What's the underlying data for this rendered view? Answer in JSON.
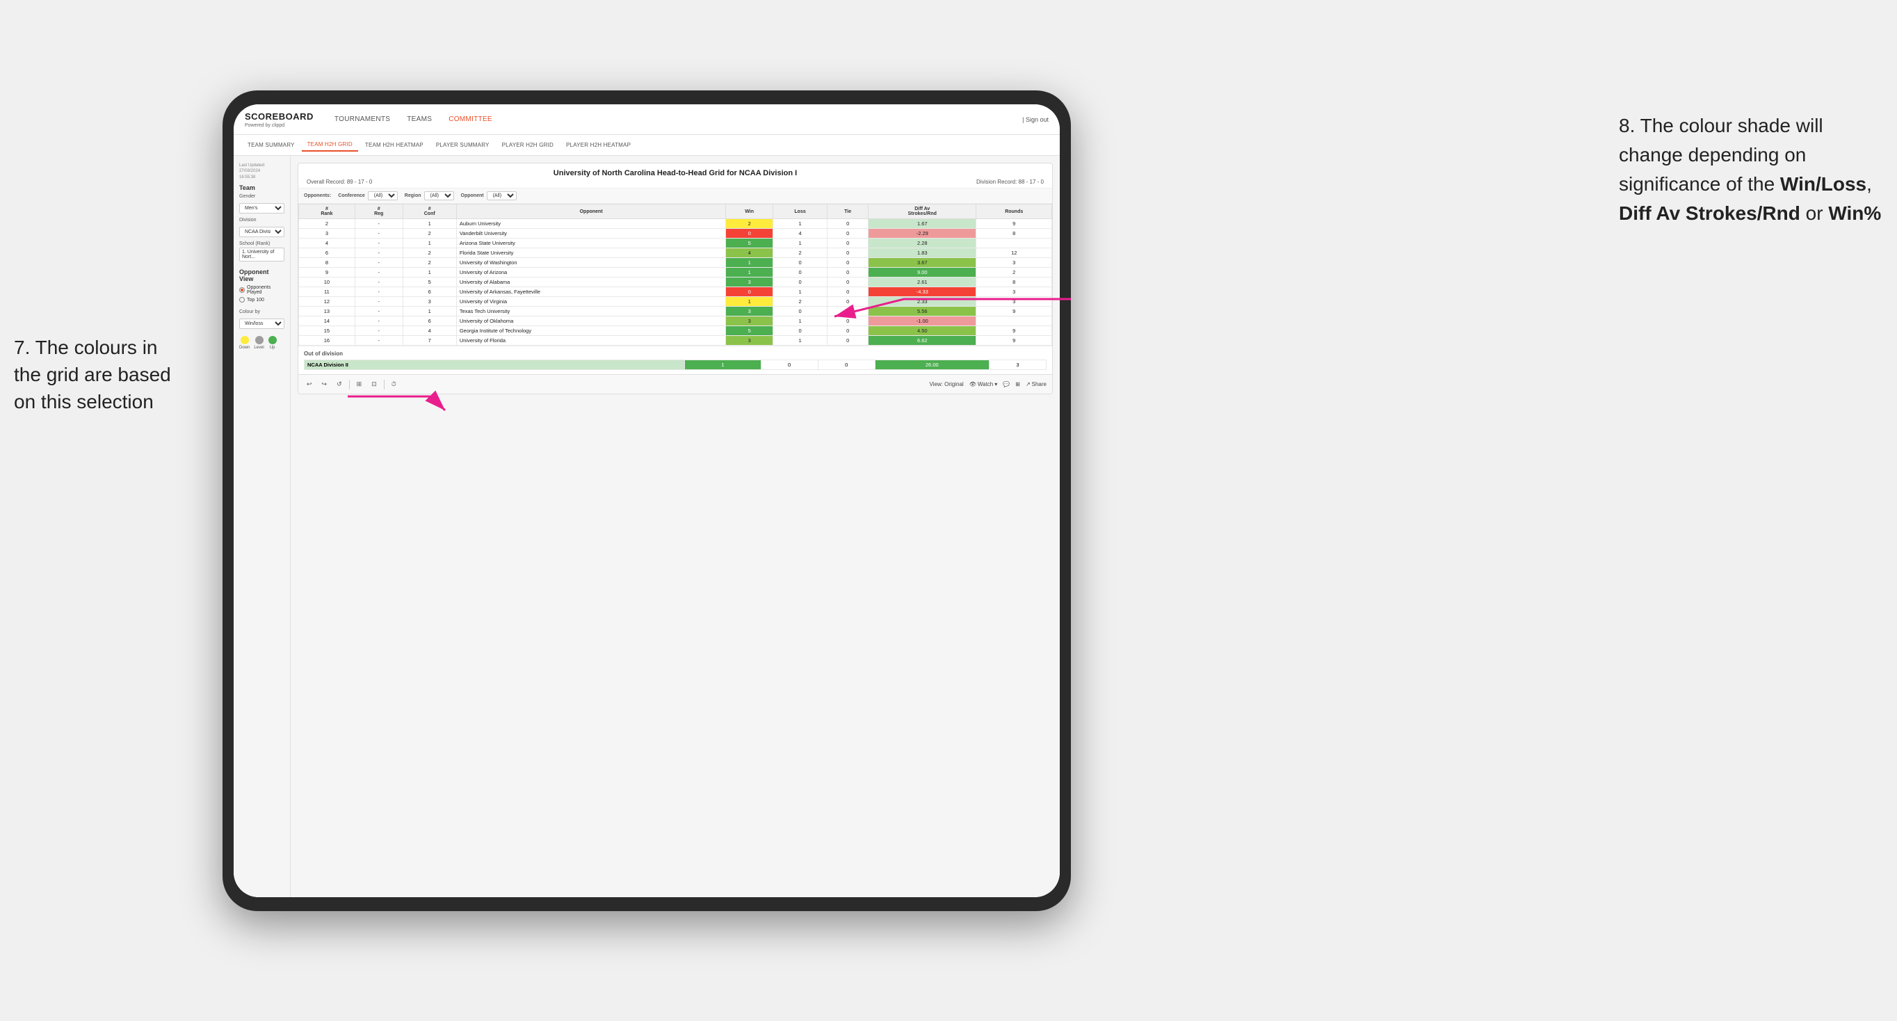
{
  "page": {
    "background": "#f0f0f0"
  },
  "annotations": {
    "left": {
      "line1": "7. The colours in",
      "line2": "the grid are based",
      "line3": "on this selection"
    },
    "right": {
      "intro": "8. The colour shade will change depending on significance of the ",
      "bold1": "Win/Loss",
      "sep1": ", ",
      "bold2": "Diff Av Strokes/Rnd",
      "sep2": " or ",
      "bold3": "Win%"
    }
  },
  "app": {
    "logo": "SCOREBOARD",
    "logo_sub": "Powered by clippd",
    "nav_items": [
      "TOURNAMENTS",
      "TEAMS",
      "COMMITTEE"
    ],
    "sign_out": "Sign out",
    "sub_nav": [
      {
        "label": "TEAM SUMMARY",
        "active": false
      },
      {
        "label": "TEAM H2H GRID",
        "active": true
      },
      {
        "label": "TEAM H2H HEATMAP",
        "active": false
      },
      {
        "label": "PLAYER SUMMARY",
        "active": false
      },
      {
        "label": "PLAYER H2H GRID",
        "active": false
      },
      {
        "label": "PLAYER H2H HEATMAP",
        "active": false
      }
    ]
  },
  "sidebar": {
    "last_updated_label": "Last Updated: 27/03/2024",
    "last_updated_time": "16:55:38",
    "team_section": "Team",
    "gender_label": "Gender",
    "gender_value": "Men's",
    "division_label": "Division",
    "division_value": "NCAA Division I",
    "school_label": "School (Rank)",
    "school_value": "1. University of Nort...",
    "opponent_view_label": "Opponent View",
    "radio_options": [
      {
        "label": "Opponents Played",
        "selected": true
      },
      {
        "label": "Top 100",
        "selected": false
      }
    ],
    "colour_by_label": "Colour by",
    "colour_by_value": "Win/loss",
    "colours": [
      {
        "label": "Down",
        "color": "#ffeb3b"
      },
      {
        "label": "Level",
        "color": "#9e9e9e"
      },
      {
        "label": "Up",
        "color": "#4caf50"
      }
    ]
  },
  "grid": {
    "title": "University of North Carolina Head-to-Head Grid for NCAA Division I",
    "overall_record_label": "Overall Record:",
    "overall_record": "89 - 17 - 0",
    "division_record_label": "Division Record:",
    "division_record": "88 - 17 - 0",
    "filters": {
      "opponents_label": "Opponents:",
      "conference_label": "Conference",
      "conference_value": "(All)",
      "region_label": "Region",
      "region_value": "(All)",
      "opponent_label": "Opponent",
      "opponent_value": "(All)"
    },
    "columns": [
      "#\nRank",
      "# Reg",
      "# Conf",
      "Opponent",
      "Win",
      "Loss",
      "Tie",
      "Diff Av\nStrokes/Rnd",
      "Rounds"
    ],
    "rows": [
      {
        "rank": "2",
        "reg": "-",
        "conf": "1",
        "opponent": "Auburn University",
        "win": "2",
        "loss": "1",
        "tie": "0",
        "diff": "1.67",
        "rounds": "9",
        "win_color": "cell-yellow",
        "diff_color": "cell-green-light"
      },
      {
        "rank": "3",
        "reg": "-",
        "conf": "2",
        "opponent": "Vanderbilt University",
        "win": "0",
        "loss": "4",
        "tie": "0",
        "diff": "-2.29",
        "rounds": "8",
        "win_color": "cell-red",
        "diff_color": "cell-red-light"
      },
      {
        "rank": "4",
        "reg": "-",
        "conf": "1",
        "opponent": "Arizona State University",
        "win": "5",
        "loss": "1",
        "tie": "0",
        "diff": "2.28",
        "rounds": "",
        "win_color": "cell-green-dark",
        "diff_color": "cell-green-light"
      },
      {
        "rank": "6",
        "reg": "-",
        "conf": "2",
        "opponent": "Florida State University",
        "win": "4",
        "loss": "2",
        "tie": "0",
        "diff": "1.83",
        "rounds": "12",
        "win_color": "cell-green-med",
        "diff_color": "cell-green-light"
      },
      {
        "rank": "8",
        "reg": "-",
        "conf": "2",
        "opponent": "University of Washington",
        "win": "1",
        "loss": "0",
        "tie": "0",
        "diff": "3.67",
        "rounds": "3",
        "win_color": "cell-green-dark",
        "diff_color": "cell-green-med"
      },
      {
        "rank": "9",
        "reg": "-",
        "conf": "1",
        "opponent": "University of Arizona",
        "win": "1",
        "loss": "0",
        "tie": "0",
        "diff": "9.00",
        "rounds": "2",
        "win_color": "cell-green-dark",
        "diff_color": "cell-green-dark"
      },
      {
        "rank": "10",
        "reg": "-",
        "conf": "5",
        "opponent": "University of Alabama",
        "win": "3",
        "loss": "0",
        "tie": "0",
        "diff": "2.61",
        "rounds": "8",
        "win_color": "cell-green-dark",
        "diff_color": "cell-green-light"
      },
      {
        "rank": "11",
        "reg": "-",
        "conf": "6",
        "opponent": "University of Arkansas, Fayetteville",
        "win": "0",
        "loss": "1",
        "tie": "0",
        "diff": "-4.33",
        "rounds": "3",
        "win_color": "cell-red",
        "diff_color": "cell-red"
      },
      {
        "rank": "12",
        "reg": "-",
        "conf": "3",
        "opponent": "University of Virginia",
        "win": "1",
        "loss": "2",
        "tie": "0",
        "diff": "2.33",
        "rounds": "3",
        "win_color": "cell-yellow",
        "diff_color": "cell-green-light"
      },
      {
        "rank": "13",
        "reg": "-",
        "conf": "1",
        "opponent": "Texas Tech University",
        "win": "3",
        "loss": "0",
        "tie": "0",
        "diff": "5.56",
        "rounds": "9",
        "win_color": "cell-green-dark",
        "diff_color": "cell-green-med"
      },
      {
        "rank": "14",
        "reg": "-",
        "conf": "6",
        "opponent": "University of Oklahoma",
        "win": "3",
        "loss": "1",
        "tie": "0",
        "diff": "-1.00",
        "rounds": "",
        "win_color": "cell-green-med",
        "diff_color": "cell-red-light"
      },
      {
        "rank": "15",
        "reg": "-",
        "conf": "4",
        "opponent": "Georgia Institute of Technology",
        "win": "5",
        "loss": "0",
        "tie": "0",
        "diff": "4.50",
        "rounds": "9",
        "win_color": "cell-green-dark",
        "diff_color": "cell-green-med"
      },
      {
        "rank": "16",
        "reg": "-",
        "conf": "7",
        "opponent": "University of Florida",
        "win": "3",
        "loss": "1",
        "tie": "0",
        "diff": "6.62",
        "rounds": "9",
        "win_color": "cell-green-med",
        "diff_color": "cell-green-dark"
      }
    ],
    "out_of_division_title": "Out of division",
    "ood_row": {
      "division": "NCAA Division II",
      "win": "1",
      "loss": "0",
      "tie": "0",
      "diff": "26.00",
      "rounds": "3",
      "win_color": "cell-green-dark",
      "diff_color": "cell-green-dark"
    }
  },
  "toolbar": {
    "view_label": "View: Original",
    "watch_label": "Watch",
    "share_label": "Share"
  }
}
